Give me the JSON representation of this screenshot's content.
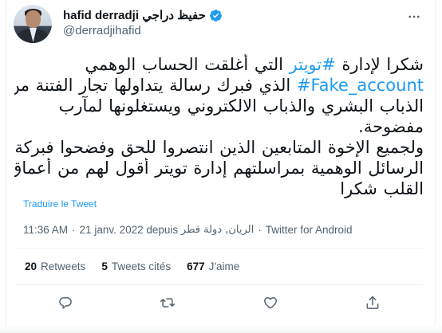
{
  "author": {
    "display_name": "hafid derradji حفيظ دراجي",
    "handle": "@derradjihafid",
    "verified": true
  },
  "tweet": {
    "lines": [
      {
        "before": "شكرا لإدارة ",
        "link": "#تويتر",
        "after": " التي أغلقت الحساب الوهمي"
      },
      {
        "before": "",
        "link": "#Fake_account",
        "after": " الذي فبرك رسالة يتداولها تجار الفتنة من"
      },
      {
        "before": "الذباب البشري والذباب الالكتروني ويستغلونها لمآرب",
        "link": "",
        "after": ""
      },
      {
        "before": "مفضوحة.",
        "link": "",
        "after": ""
      },
      {
        "before": "ولجميع الإخوة المتابعين الذين انتصروا للحق وفضحوا فبركة",
        "link": "",
        "after": ""
      },
      {
        "before": "الرسائل الوهمية بمراسلتهم إدارة تويتر أقول لهم من أعماق",
        "link": "",
        "after": ""
      },
      {
        "before": "القلب شكرا",
        "link": "",
        "after": ""
      }
    ],
    "translate_label": "Traduire le Tweet",
    "time": "11:36 AM",
    "date_place_prefix": "21 janv. 2022 depuis",
    "place": "الريان, دولة قطر",
    "source": "Twitter for Android"
  },
  "stats": {
    "retweets_count": "20",
    "retweets_label": "Retweets",
    "quotes_count": "5",
    "quotes_label": "Tweets cités",
    "likes_count": "677",
    "likes_label": "J'aime"
  },
  "icons": {
    "more": "more-dots-icon",
    "verified": "verified-badge-icon",
    "reply": "reply-icon",
    "retweet": "retweet-icon",
    "like": "heart-icon",
    "share": "share-icon"
  },
  "colors": {
    "accent": "#1d9bf0",
    "text": "#0f1419",
    "secondary": "#536471"
  }
}
